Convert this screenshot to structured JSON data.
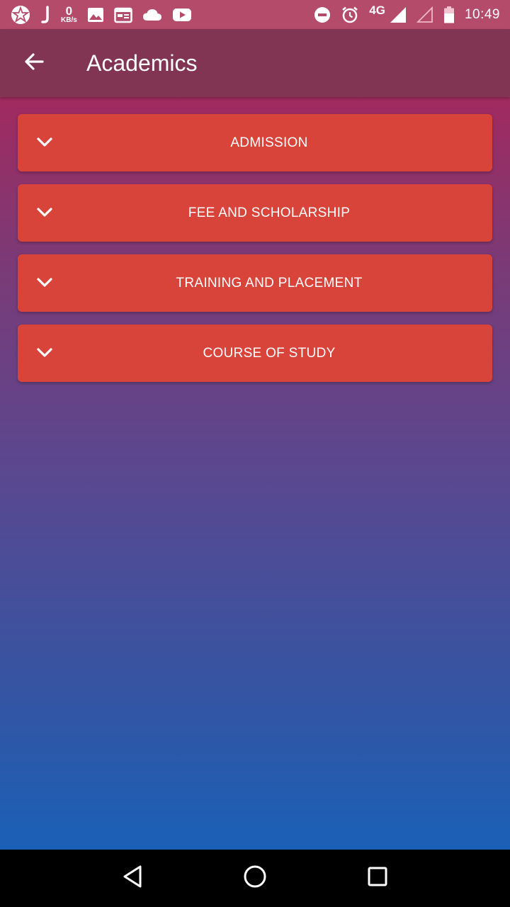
{
  "status_bar": {
    "speed_value": "0",
    "speed_unit": "KB/s",
    "network": "4G",
    "time": "10:49",
    "icons_left": [
      "app-star-icon",
      "j-icon",
      "image-icon",
      "calendar-icon",
      "cloud-icon",
      "youtube-icon"
    ],
    "icons_right": [
      "dnd-icon",
      "alarm-icon",
      "signal-icon",
      "signal-empty-icon",
      "battery-icon"
    ]
  },
  "app_bar": {
    "title": "Academics",
    "back_icon": "arrow-left-icon",
    "background": "#813552"
  },
  "accordion": {
    "color": "#d9443a",
    "items": [
      {
        "label": "ADMISSION"
      },
      {
        "label": "FEE AND SCHOLARSHIP"
      },
      {
        "label": "TRAINING AND PLACEMENT"
      },
      {
        "label": "COURSE OF STUDY"
      }
    ]
  },
  "nav_bar": {
    "buttons": [
      "back-triangle-icon",
      "home-circle-icon",
      "recents-square-icon"
    ]
  }
}
